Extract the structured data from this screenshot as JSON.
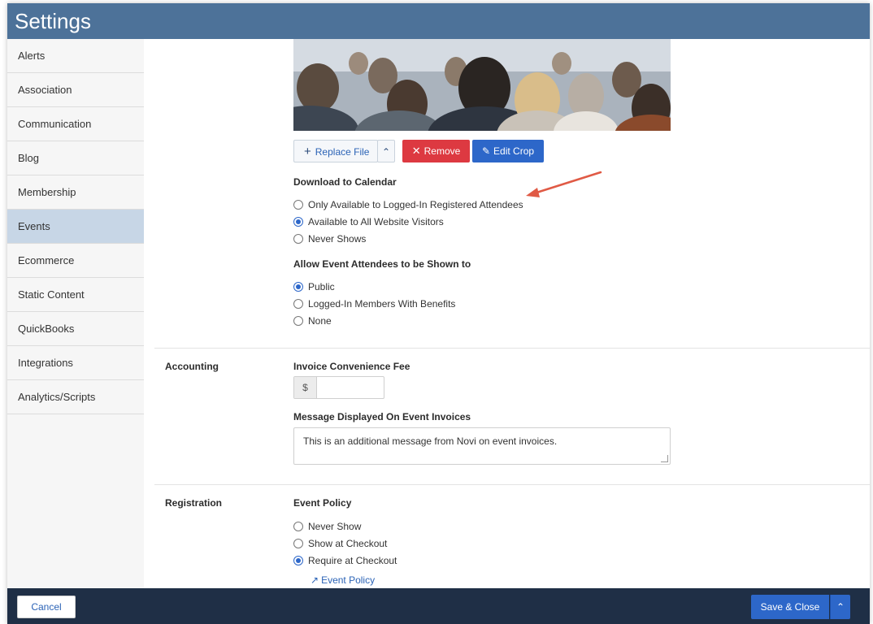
{
  "window": {
    "title": "Settings"
  },
  "sidebar": {
    "items": [
      {
        "label": "Alerts"
      },
      {
        "label": "Association"
      },
      {
        "label": "Communication"
      },
      {
        "label": "Blog"
      },
      {
        "label": "Membership"
      },
      {
        "label": "Events"
      },
      {
        "label": "Ecommerce"
      },
      {
        "label": "Static Content"
      },
      {
        "label": "QuickBooks"
      },
      {
        "label": "Integrations"
      },
      {
        "label": "Analytics/Scripts"
      }
    ],
    "active": "Events"
  },
  "image_toolbar": {
    "replace_label": "Replace File",
    "remove_label": "Remove",
    "edit_crop_label": "Edit Crop"
  },
  "download_calendar": {
    "heading": "Download to Calendar",
    "options": [
      {
        "label": "Only Available to Logged-In Registered Attendees",
        "checked": false
      },
      {
        "label": "Available to All Website Visitors",
        "checked": true
      },
      {
        "label": "Never Shows",
        "checked": false
      }
    ]
  },
  "attendees": {
    "heading": "Allow Event Attendees to be Shown to",
    "options": [
      {
        "label": "Public",
        "checked": true
      },
      {
        "label": "Logged-In Members With Benefits",
        "checked": false
      },
      {
        "label": "None",
        "checked": false
      }
    ]
  },
  "accounting": {
    "section_label": "Accounting",
    "fee_heading": "Invoice Convenience Fee",
    "fee_prefix": "$",
    "fee_value": "",
    "message_heading": "Message Displayed On Event Invoices",
    "message_value": "This is an additional message from Novi on event invoices."
  },
  "registration": {
    "section_label": "Registration",
    "policy_heading": "Event Policy",
    "options": [
      {
        "label": "Never Show",
        "checked": false
      },
      {
        "label": "Show at Checkout",
        "checked": false
      },
      {
        "label": "Require at Checkout",
        "checked": true
      }
    ],
    "policy_link": "Event Policy"
  },
  "footer": {
    "cancel_label": "Cancel",
    "save_label": "Save & Close"
  },
  "colors": {
    "header": "#4d7299",
    "footer": "#1f2f46",
    "primary": "#2d67c9",
    "danger": "#dd3941",
    "annotation_arrow": "#e05a45"
  }
}
